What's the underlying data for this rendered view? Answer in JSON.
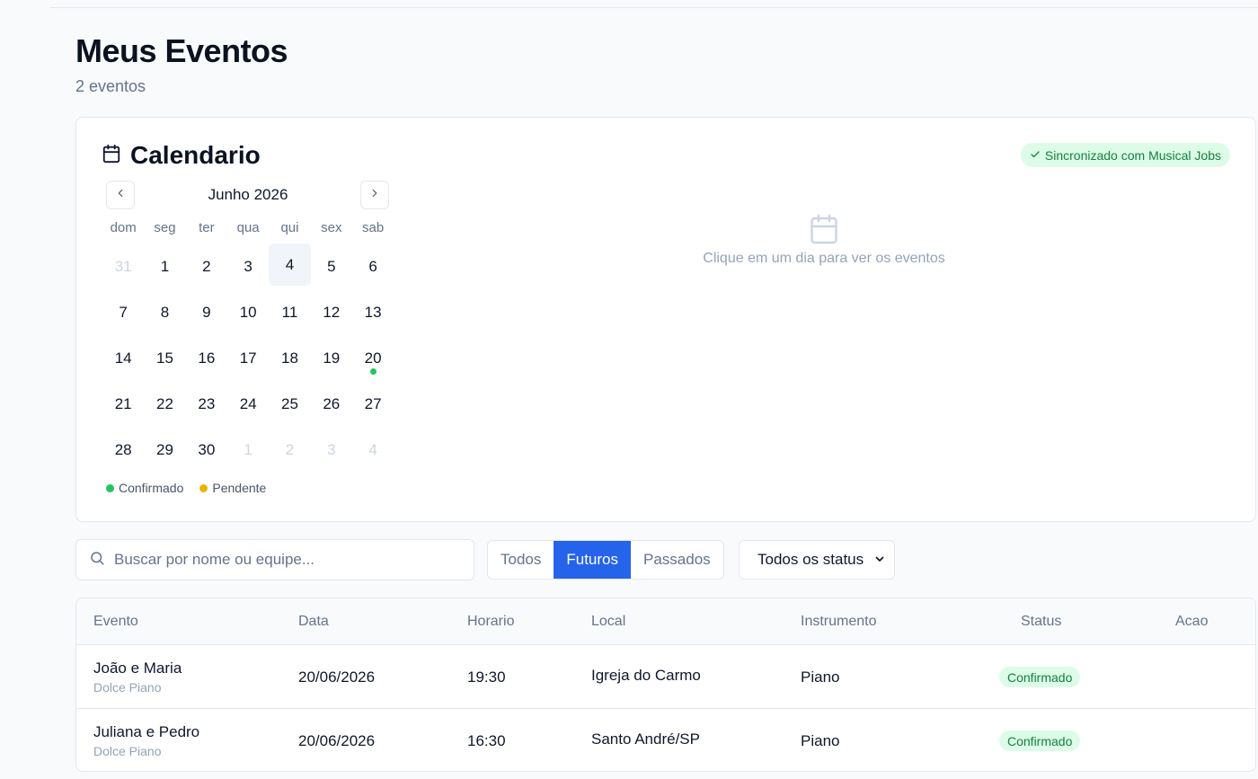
{
  "page": {
    "title": "Meus Eventos",
    "subtitle": "2 eventos"
  },
  "calendar": {
    "title": "Calendario",
    "sync_badge": "Sincronizado com Musical Jobs",
    "month_label": "Junho 2026",
    "weekdays": [
      "dom",
      "seg",
      "ter",
      "qua",
      "qui",
      "sex",
      "sab"
    ],
    "days": [
      {
        "n": "31",
        "muted": true
      },
      {
        "n": "1"
      },
      {
        "n": "2"
      },
      {
        "n": "3"
      },
      {
        "n": "4",
        "today": true
      },
      {
        "n": "5"
      },
      {
        "n": "6"
      },
      {
        "n": "7"
      },
      {
        "n": "8"
      },
      {
        "n": "9"
      },
      {
        "n": "10"
      },
      {
        "n": "11"
      },
      {
        "n": "12"
      },
      {
        "n": "13"
      },
      {
        "n": "14"
      },
      {
        "n": "15"
      },
      {
        "n": "16"
      },
      {
        "n": "17"
      },
      {
        "n": "18"
      },
      {
        "n": "19"
      },
      {
        "n": "20",
        "dot": "confirmed"
      },
      {
        "n": "21"
      },
      {
        "n": "22"
      },
      {
        "n": "23"
      },
      {
        "n": "24"
      },
      {
        "n": "25"
      },
      {
        "n": "26"
      },
      {
        "n": "27"
      },
      {
        "n": "28"
      },
      {
        "n": "29"
      },
      {
        "n": "30"
      },
      {
        "n": "1",
        "muted": true
      },
      {
        "n": "2",
        "muted": true
      },
      {
        "n": "3",
        "muted": true
      },
      {
        "n": "4",
        "muted": true
      }
    ],
    "legend": {
      "confirmed": "Confirmado",
      "pending": "Pendente"
    },
    "empty_text": "Clique em um dia para ver os eventos"
  },
  "filters": {
    "search_placeholder": "Buscar por nome ou equipe...",
    "segments": [
      "Todos",
      "Futuros",
      "Passados"
    ],
    "active_segment": "Futuros",
    "status_select": "Todos os status"
  },
  "table": {
    "headers": {
      "evento": "Evento",
      "data": "Data",
      "horario": "Horario",
      "local": "Local",
      "instrumento": "Instrumento",
      "status": "Status",
      "acao": "Acao"
    },
    "rows": [
      {
        "name": "João e Maria",
        "team": "Dolce Piano",
        "date": "20/06/2026",
        "time": "19:30",
        "place": "Igreja do Carmo",
        "instrument": "Piano",
        "status": "Confirmado"
      },
      {
        "name": "Juliana e Pedro",
        "team": "Dolce Piano",
        "date": "20/06/2026",
        "time": "16:30",
        "place": "Santo André/SP",
        "instrument": "Piano",
        "status": "Confirmado"
      }
    ]
  },
  "colors": {
    "accent": "#2563eb",
    "confirmed": "#22c55e",
    "pending": "#eab308",
    "badge_bg": "#dcfce7",
    "badge_text": "#15803d"
  },
  "icons": {
    "calendar": "calendar-icon",
    "check": "check-icon",
    "prev": "chevron-left-icon",
    "next": "chevron-right-icon",
    "search": "search-icon",
    "dropdown": "chevron-down-icon"
  }
}
